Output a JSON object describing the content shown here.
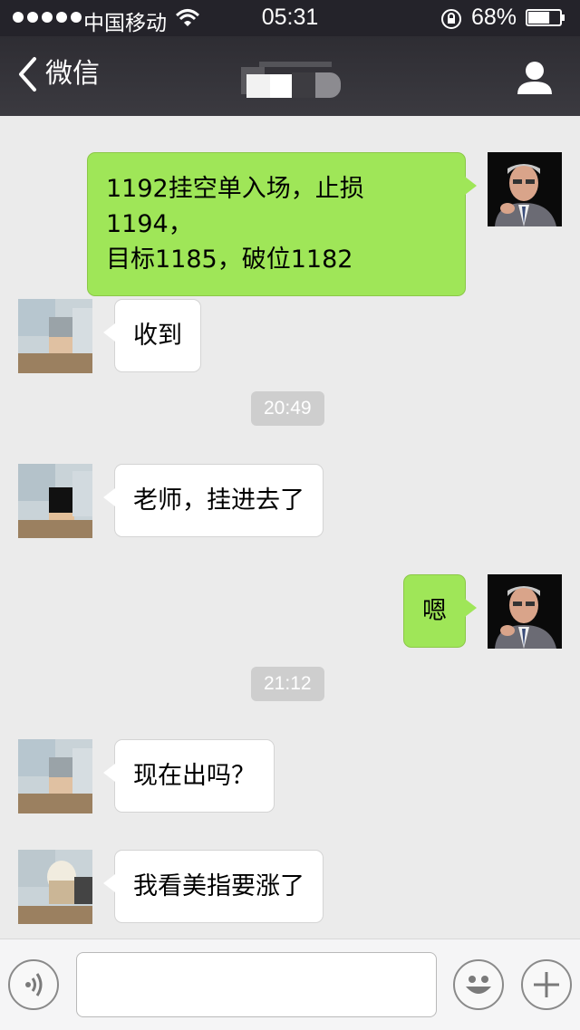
{
  "status_bar": {
    "carrier": "中国移动",
    "time": "05:31",
    "battery_percent": "68%",
    "battery_level": 0.68,
    "signal_bars": 5
  },
  "nav": {
    "back_label": "微信",
    "back_icon": "chevron-left-icon",
    "profile_icon": "person-icon"
  },
  "messages": [
    {
      "side": "out",
      "lines": [
        "1192挂空单入场，止损1194，",
        "目标1185，破位1182"
      ]
    },
    {
      "side": "in",
      "lines": [
        "收到"
      ]
    },
    {
      "type": "time",
      "text": "20:49"
    },
    {
      "side": "in",
      "lines": [
        "老师，挂进去了"
      ]
    },
    {
      "side": "out",
      "lines": [
        "嗯"
      ]
    },
    {
      "type": "time",
      "text": "21:12"
    },
    {
      "side": "in",
      "lines": [
        "现在出吗？"
      ]
    },
    {
      "side": "in",
      "lines": [
        "我看美指要涨了"
      ]
    }
  ],
  "input_bar": {
    "voice_icon": "voice-icon",
    "emoji_icon": "emoji-icon",
    "plus_icon": "plus-icon",
    "text_value": ""
  },
  "colors": {
    "outgoing_bubble": "#9fe658",
    "incoming_bubble": "#ffffff",
    "chat_background": "#ebebeb",
    "nav_background": "#2e2d33"
  }
}
